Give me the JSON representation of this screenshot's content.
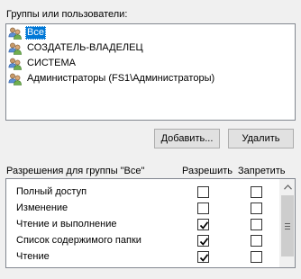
{
  "groups_label": "Группы или пользователи:",
  "users": [
    {
      "name": "Все",
      "selected": true,
      "icon": "user-group-icon"
    },
    {
      "name": "СОЗДАТЕЛЬ-ВЛАДЕЛЕЦ",
      "selected": false,
      "icon": "user-group-icon"
    },
    {
      "name": "СИСТЕМА",
      "selected": false,
      "icon": "user-group-icon"
    },
    {
      "name": "Администраторы (FS1\\Администраторы)",
      "selected": false,
      "icon": "user-group-icon"
    }
  ],
  "buttons": {
    "add": "Добавить...",
    "remove": "Удалить"
  },
  "permissions_header": {
    "title": "Разрешения для группы \"Все\"",
    "allow": "Разрешить",
    "deny": "Запретить"
  },
  "permissions": [
    {
      "label": "Полный доступ",
      "allow": false,
      "deny": false
    },
    {
      "label": "Изменение",
      "allow": false,
      "deny": false
    },
    {
      "label": "Чтение и выполнение",
      "allow": true,
      "deny": false
    },
    {
      "label": "Список содержимого папки",
      "allow": true,
      "deny": false
    },
    {
      "label": "Чтение",
      "allow": true,
      "deny": false
    }
  ],
  "colors": {
    "selection": "#0078d7",
    "background": "#f0f0f0"
  }
}
